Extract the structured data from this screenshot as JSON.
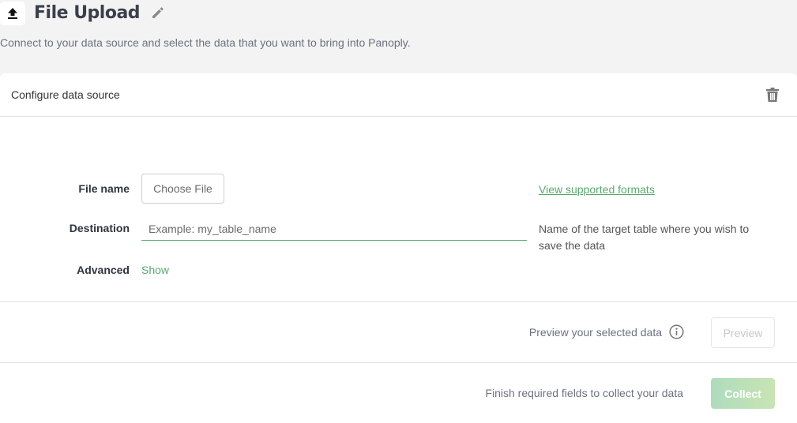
{
  "header": {
    "icon": "upload-icon",
    "title": "File Upload",
    "edit_icon": "pencil-icon"
  },
  "subtitle": "Connect to your data source and select the data that you want to bring into Panoply.",
  "card": {
    "title": "Configure data source",
    "delete_icon": "trash-icon"
  },
  "form": {
    "file_name_label": "File name",
    "choose_file_label": "Choose File",
    "formats_link": "View supported formats",
    "destination_label": "Destination",
    "destination_value": "",
    "destination_placeholder": "Example: my_table_name",
    "destination_help": "Name of the target table where you wish to save the data",
    "advanced_label": "Advanced",
    "advanced_toggle": "Show"
  },
  "preview": {
    "text": "Preview your selected data",
    "info_icon": "info-icon",
    "button_label": "Preview"
  },
  "collect": {
    "text": "Finish required fields to collect your data",
    "button_label": "Collect"
  },
  "colors": {
    "accent_green": "#5aa96f",
    "input_underline": "#4caf6e",
    "collect_gradient_start": "#aedcbe",
    "collect_gradient_end": "#c9e4b4",
    "page_background": "#f3f3f3"
  }
}
